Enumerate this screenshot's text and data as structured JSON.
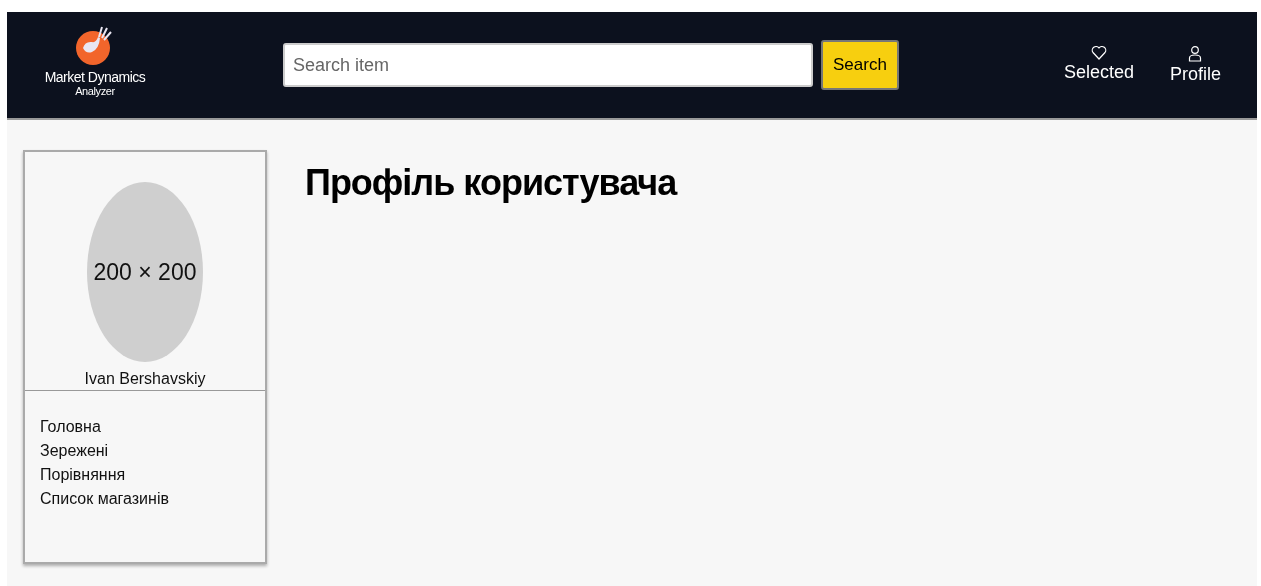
{
  "header": {
    "logo": {
      "title": "Market Dynamics",
      "subtitle": "Analyzer"
    },
    "search": {
      "placeholder": "Search item",
      "button": "Search"
    },
    "nav": [
      {
        "label": "Selected",
        "kind": "heart"
      },
      {
        "label": "Profile",
        "kind": "user"
      }
    ]
  },
  "sidebar": {
    "avatar": {
      "text": "200 × 200"
    },
    "user_name": "Ivan Bershavskiy",
    "menu": [
      "Головна",
      "Зережені",
      "Порівняння",
      "Список магазинів"
    ]
  },
  "main": {
    "title": "Профіль користувача"
  }
}
